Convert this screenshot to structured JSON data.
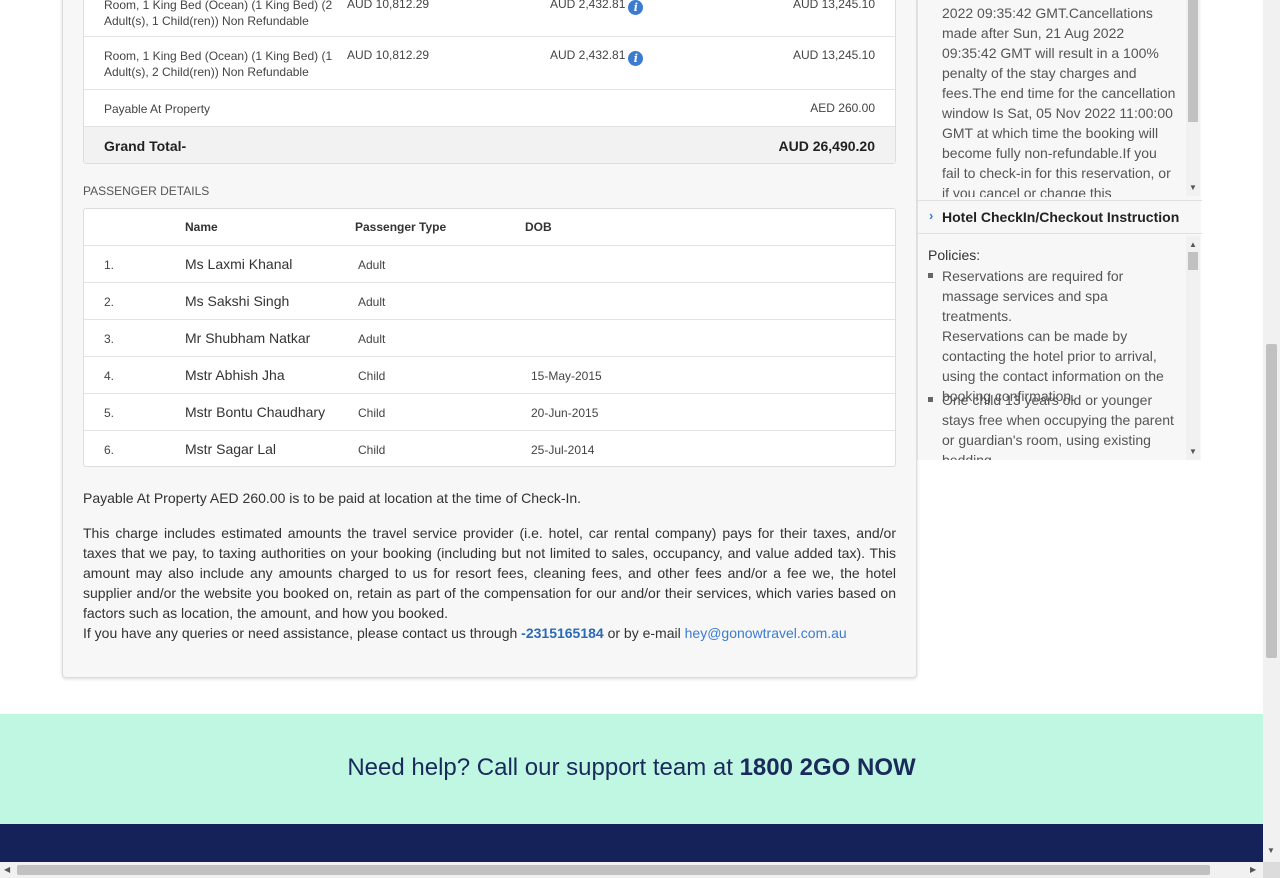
{
  "fares": [
    {
      "desc": "Room, 1 King Bed (Ocean) (1 King Bed) (2 Adult(s), 1 Child(ren)) Non Refundable",
      "base": "AUD 10,812.29",
      "tax": "AUD 2,432.81",
      "total": "AUD 13,245.10"
    },
    {
      "desc": "Room, 1 King Bed (Ocean) (1 King Bed) (1 Adult(s), 2 Child(ren)) Non Refundable",
      "base": "AUD 10,812.29",
      "tax": "AUD 2,432.81",
      "total": "AUD 13,245.10"
    }
  ],
  "payable": {
    "label": "Payable At Property",
    "value": "AED 260.00"
  },
  "grand_total": {
    "label": "Grand Total-",
    "value": "AUD 26,490.20"
  },
  "info_icon": "i",
  "passenger_section": "PASSENGER DETAILS",
  "pax_headers": {
    "name": "Name",
    "type": "Passenger Type",
    "dob": "DOB"
  },
  "passengers": [
    {
      "num": "1.",
      "name": "Ms Laxmi Khanal",
      "type": "Adult",
      "dob": ""
    },
    {
      "num": "2.",
      "name": "Ms Sakshi Singh",
      "type": "Adult",
      "dob": ""
    },
    {
      "num": "3.",
      "name": "Mr Shubham Natkar",
      "type": "Adult",
      "dob": ""
    },
    {
      "num": "4.",
      "name": "Mstr Abhish Jha",
      "type": "Child",
      "dob": "15-May-2015"
    },
    {
      "num": "5.",
      "name": "Mstr Bontu Chaudhary",
      "type": "Child",
      "dob": "20-Jun-2015"
    },
    {
      "num": "6.",
      "name": "Mstr Sagar Lal",
      "type": "Child",
      "dob": "25-Jul-2014"
    }
  ],
  "notes": {
    "payable": "Payable At Property AED 260.00 is to be paid at location at the time of Check-In.",
    "charge": "This charge includes estimated amounts the travel service provider (i.e. hotel, car rental company) pays for their taxes, and/or taxes that we pay, to taxing authorities on your booking (including but not limited to sales, occupancy, and value added tax). This amount may also include any amounts charged to us for resort fees, cleaning fees, and other fees and/or a fee we, the hotel supplier and/or the website you booked on, retain as part of the compensation for our and/or their services, which varies based on factors such as location, the amount, and how you booked.",
    "contact_prefix": "If you have any queries or need assistance, please contact us through",
    "phone": "-2315165184",
    "contact_mid": "or by e-mail",
    "email": "hey@gonowtravel.com.au"
  },
  "side": {
    "cancellation_lines": [
      "2022 09:35:42 GMT.Cancellations",
      "made after Sun, 21 Aug 2022",
      "09:35:42 GMT will result in a 100%",
      "penalty of the stay charges and",
      "fees.The end time for the cancellation",
      "window Is Sat, 05 Nov 2022 11:00:00",
      "GMT at which time the booking will",
      "become fully non-refundable.If you",
      "fail to check-in for this reservation, or",
      "if you cancel or change this"
    ],
    "accordion_label": "Hotel CheckIn/Checkout Instruction",
    "policies_label": "Policies:",
    "policy_1": [
      "Reservations are required for",
      "massage services and spa treatments.",
      "Reservations can be made by",
      "contacting the hotel prior to arrival,",
      "using the contact information on the",
      "booking confirmation."
    ],
    "policy_2": [
      "One child 13 years old or younger",
      "stays free when occupying the parent",
      "or guardian's room, using existing",
      "bedding."
    ]
  },
  "help": {
    "prefix": "Need help? Call our support team at",
    "number": "1800 2GO NOW"
  }
}
